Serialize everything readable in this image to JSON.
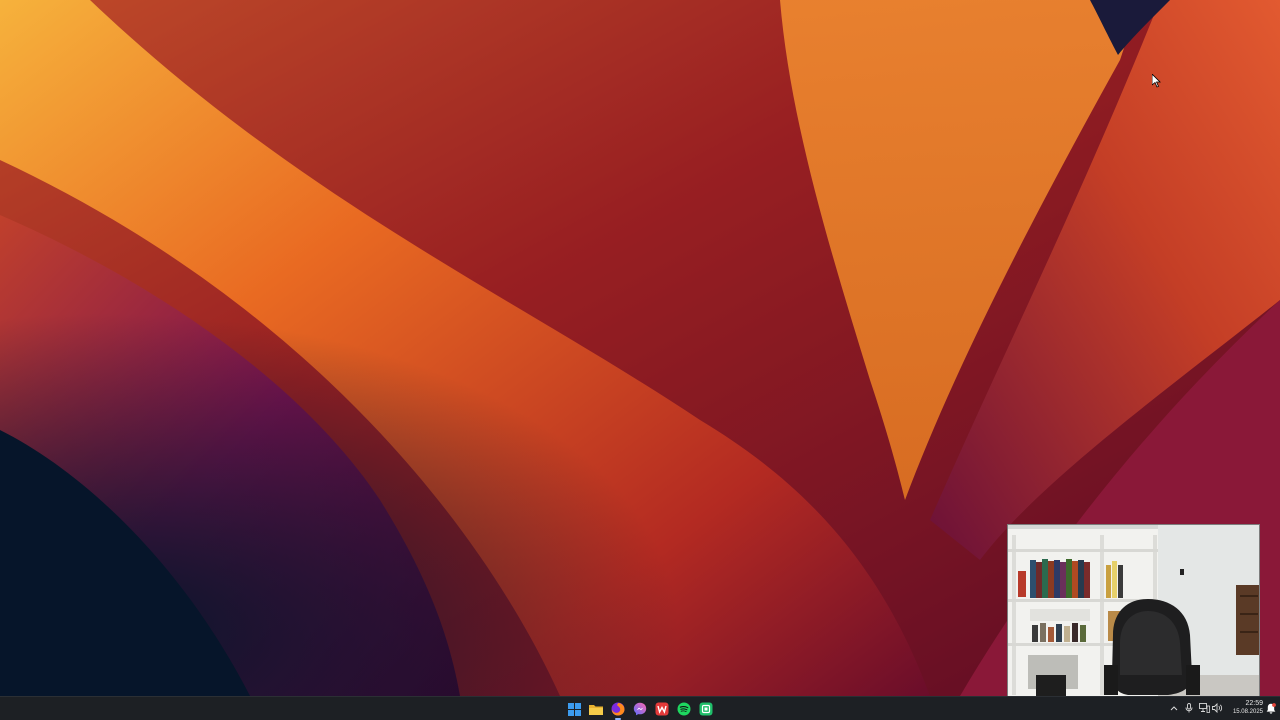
{
  "screen": {
    "wallpaper": "orange-red-magenta petal abstract",
    "colors": {
      "taskbar": "#1d2024",
      "tray_text": "#e8e8e8",
      "accent_windows": "#3c9cf0",
      "notification": "#e7463b"
    }
  },
  "overlay": {
    "webcam": "webcam overlay showing a room with bookshelves and a black office chair"
  },
  "taskbar": {
    "apps": [
      {
        "name": "Start",
        "icon": "windows-logo-icon"
      },
      {
        "name": "File Explorer",
        "icon": "folder-icon"
      },
      {
        "name": "Firefox",
        "icon": "firefox-icon",
        "active": true
      },
      {
        "name": "Messenger",
        "icon": "messenger-icon"
      },
      {
        "name": "WPS Office",
        "icon": "wps-office-icon"
      },
      {
        "name": "Spotify",
        "icon": "spotify-icon"
      },
      {
        "name": "App",
        "icon": "green-app-icon"
      }
    ],
    "tray": {
      "icons": [
        "chevron-up-icon",
        "microphone-icon",
        "network-icon",
        "speaker-icon",
        "notification-icon"
      ],
      "time": "22:59",
      "date": "15.08.2025"
    }
  }
}
